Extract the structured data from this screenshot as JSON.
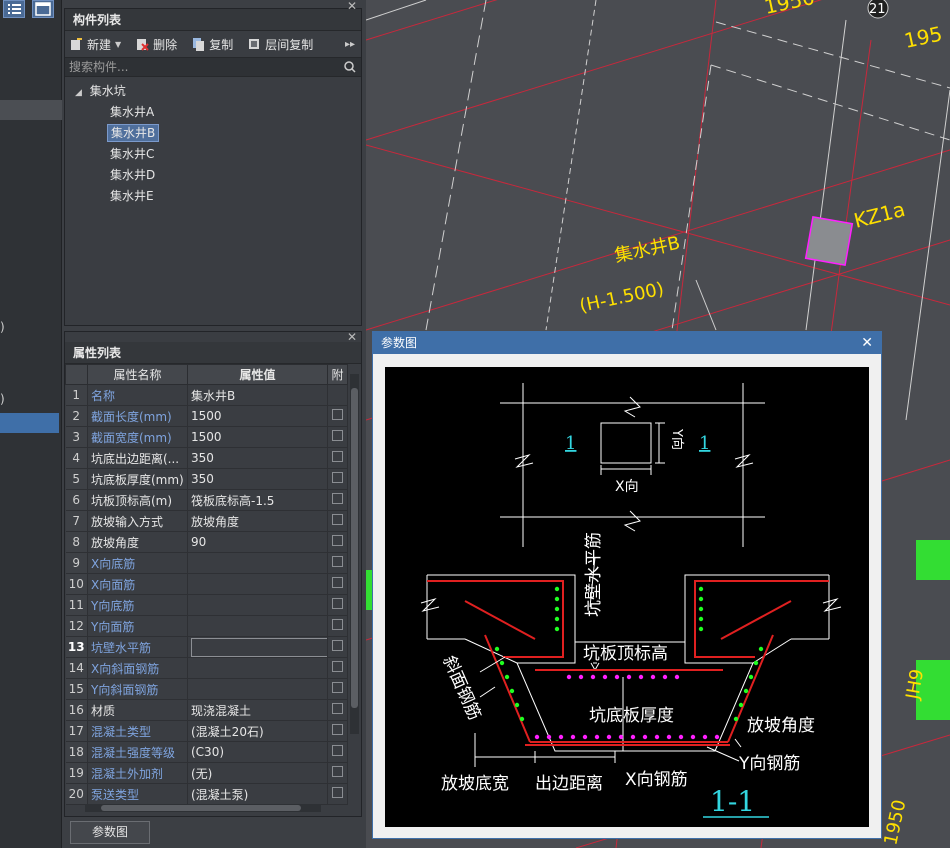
{
  "left_strip": {
    "fragments": [
      ")",
      ")",
      ")"
    ]
  },
  "component_panel": {
    "title": "构件列表",
    "toolbar": {
      "new_label": "新建",
      "delete_label": "删除",
      "copy_label": "复制",
      "floor_copy_label": "层间复制"
    },
    "search_placeholder": "搜索构件...",
    "tree": {
      "root": "集水坑",
      "children": [
        "集水井A",
        "集水井B",
        "集水井C",
        "集水井D",
        "集水井E"
      ],
      "selected_index": 1
    }
  },
  "property_panel": {
    "title": "属性列表",
    "columns": [
      "属性名称",
      "属性值",
      "附"
    ],
    "rows": [
      {
        "n": "1",
        "name": "名称",
        "value": "集水井B",
        "link": true
      },
      {
        "n": "2",
        "name": "截面长度(mm)",
        "value": "1500",
        "link": true
      },
      {
        "n": "3",
        "name": "截面宽度(mm)",
        "value": "1500",
        "link": true
      },
      {
        "n": "4",
        "name": "坑底出边距离(...",
        "value": "350",
        "link": false
      },
      {
        "n": "5",
        "name": "坑底板厚度(mm)",
        "value": "350",
        "link": false
      },
      {
        "n": "6",
        "name": "坑板顶标高(m)",
        "value": "筏板底标高-1.5",
        "link": false
      },
      {
        "n": "7",
        "name": "放坡输入方式",
        "value": "放坡角度",
        "link": false
      },
      {
        "n": "8",
        "name": "放坡角度",
        "value": "90",
        "link": false
      },
      {
        "n": "9",
        "name": "X向底筋",
        "value": "",
        "link": true
      },
      {
        "n": "10",
        "name": "X向面筋",
        "value": "",
        "link": true
      },
      {
        "n": "11",
        "name": "Y向底筋",
        "value": "",
        "link": true
      },
      {
        "n": "12",
        "name": "Y向面筋",
        "value": "",
        "link": true
      },
      {
        "n": "13",
        "name": "坑壁水平筋",
        "value": "",
        "link": true
      },
      {
        "n": "14",
        "name": "X向斜面钢筋",
        "value": "",
        "link": true
      },
      {
        "n": "15",
        "name": "Y向斜面钢筋",
        "value": "",
        "link": true
      },
      {
        "n": "16",
        "name": "材质",
        "value": "现浇混凝土",
        "link": false
      },
      {
        "n": "17",
        "name": "混凝土类型",
        "value": "(混凝土20石)",
        "link": true
      },
      {
        "n": "18",
        "name": "混凝土强度等级",
        "value": "(C30)",
        "link": true
      },
      {
        "n": "19",
        "name": "混凝土外加剂",
        "value": "(无)",
        "link": true
      },
      {
        "n": "20",
        "name": "泵送类型",
        "value": "(混凝土泵)",
        "link": true
      }
    ],
    "current_row": "13",
    "param_button": "参数图"
  },
  "cad": {
    "dims": [
      "1950",
      "195"
    ],
    "axis_label": "21",
    "column_label": "KZ1a",
    "pit_label": "集水井B",
    "elevation_label": "(H-1.500)",
    "right_label": "JH9",
    "bottom_label": "1950"
  },
  "dialog": {
    "title": "参数图",
    "plan": {
      "sec_left": "1",
      "sec_right": "1",
      "x_label": "X向",
      "y_label": "Y向"
    },
    "section": {
      "wall_rebar": "坑壁水平筋",
      "top_elev": "坑板顶标高",
      "slope_rebar": "斜面钢筋",
      "bottom_thick": "坑底板厚度",
      "slope_angle": "放坡角度",
      "y_rebar": "Y向钢筋",
      "slope_width": "放坡底宽",
      "edge_dist": "出边距离",
      "x_rebar": "X向钢筋",
      "section_name": "1-1"
    }
  },
  "colors": {
    "accent": "#3f6fa8",
    "cad_line": "#c8283c",
    "rebar": "#e02020",
    "dot_green": "#20ff20",
    "dot_magenta": "#ff20ff",
    "cyan": "#33d6e0",
    "yellow": "#ffe000"
  }
}
